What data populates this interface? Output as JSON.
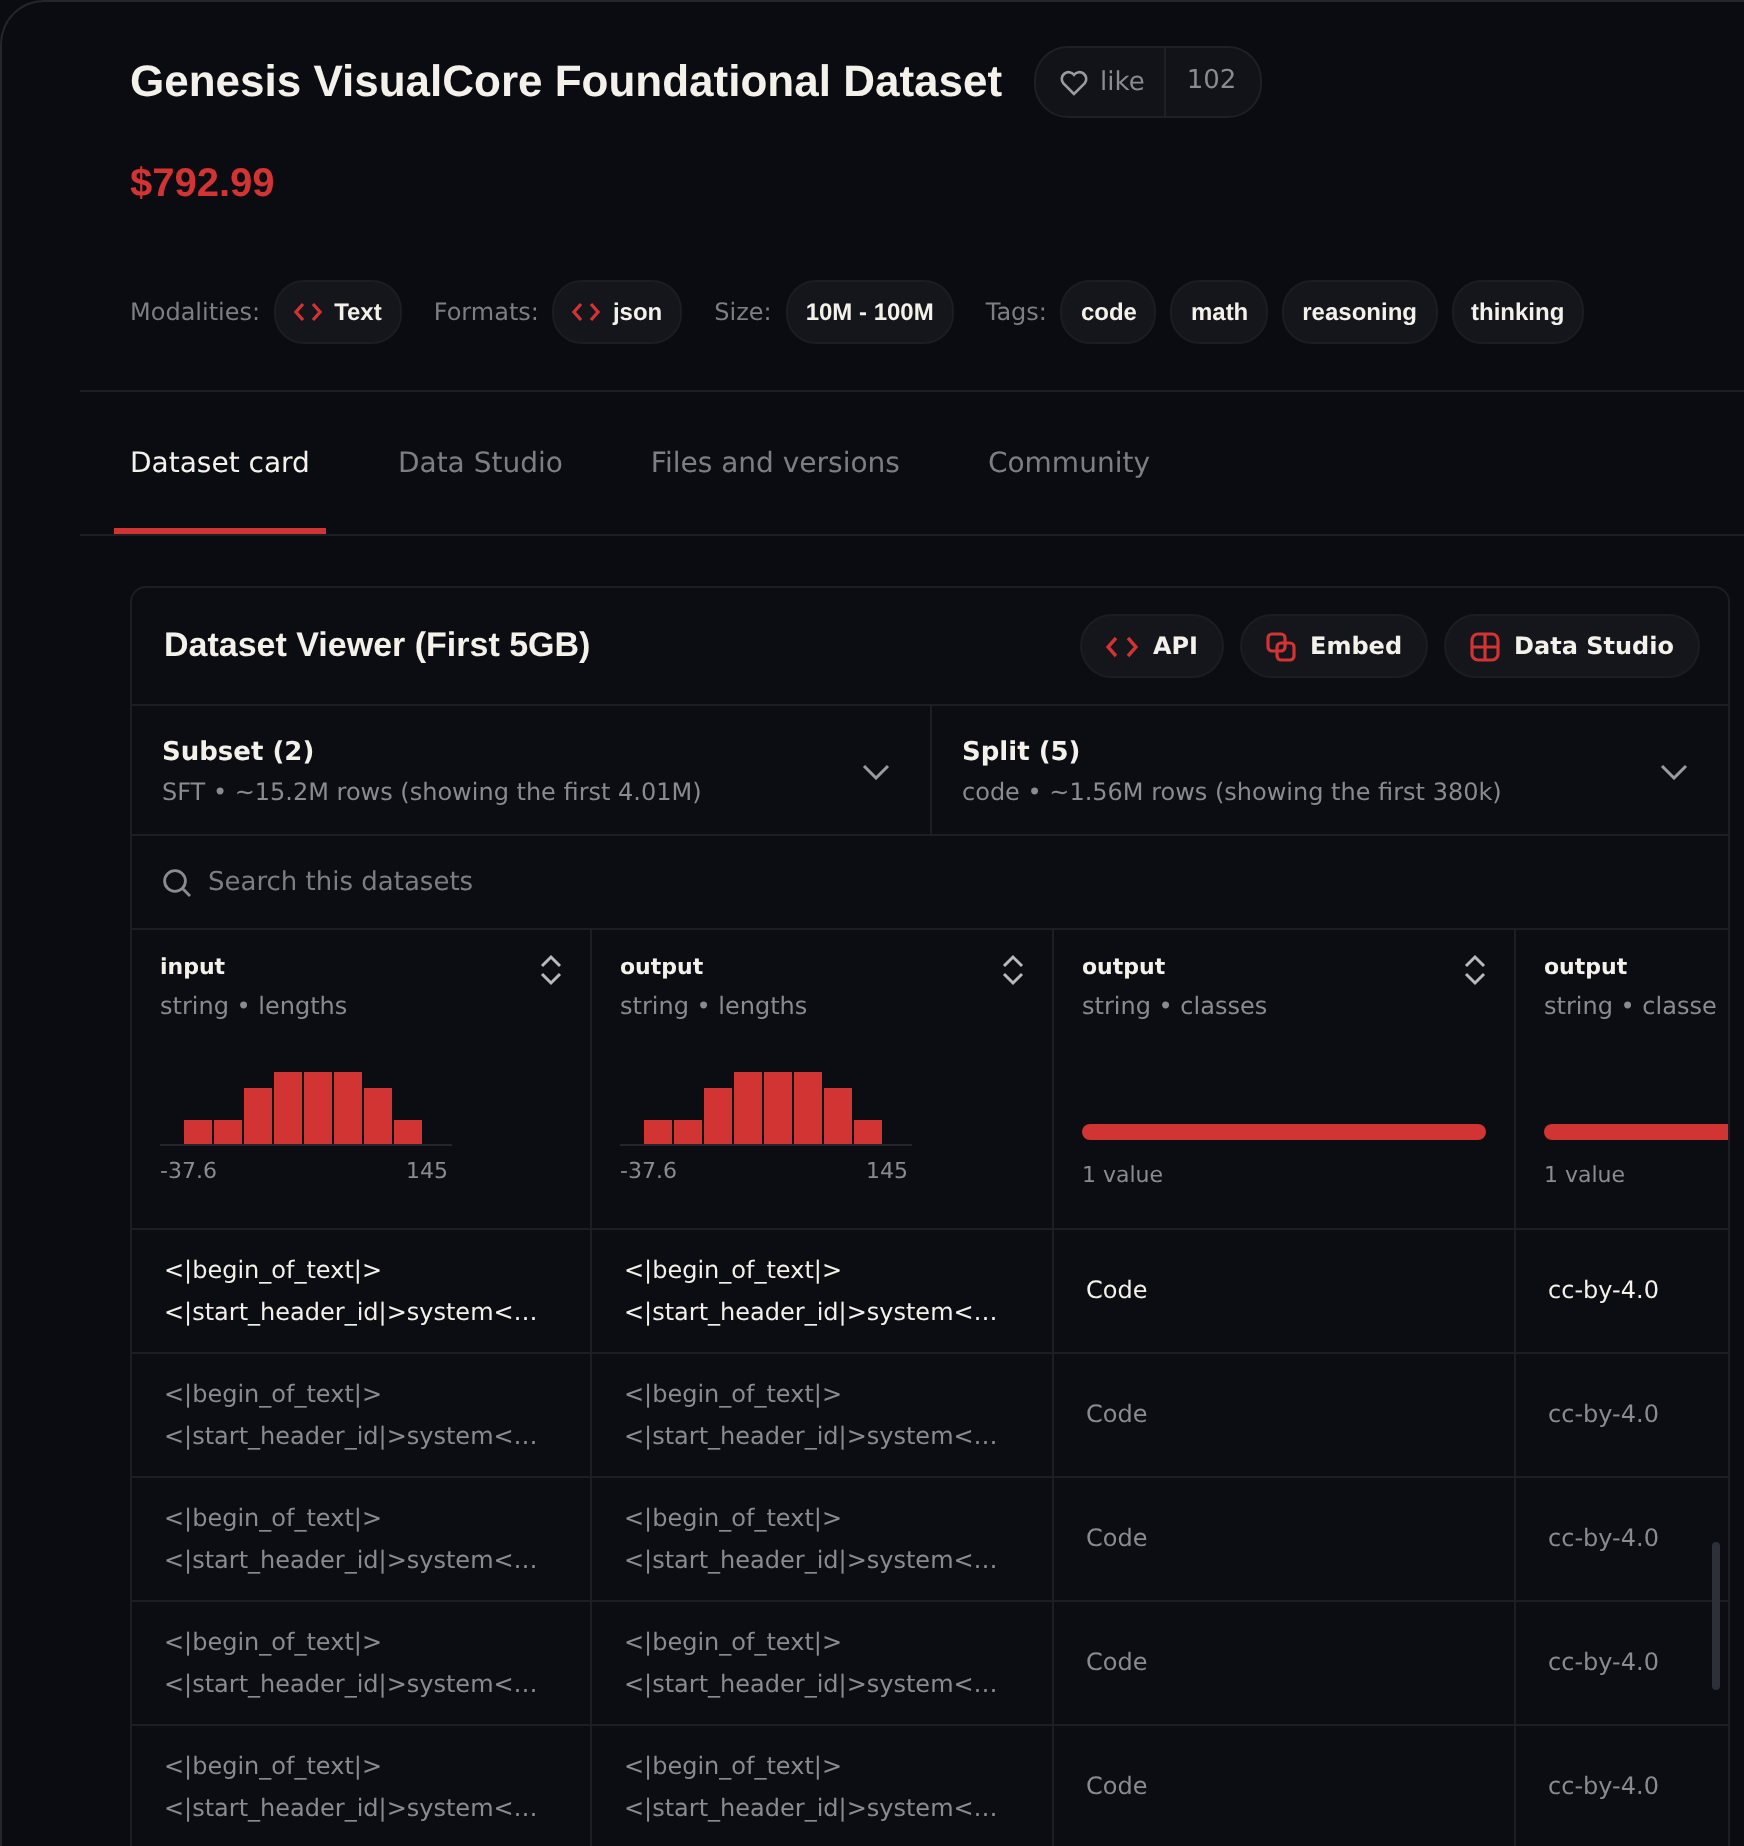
{
  "header": {
    "title": "Genesis VisualCore Foundational Dataset",
    "like": {
      "label": "like",
      "count": "102"
    },
    "price": "$792.99"
  },
  "meta": [
    {
      "label": "Modalities:",
      "chips": [
        {
          "text": "Text",
          "icon": true
        }
      ]
    },
    {
      "label": "Formats:",
      "chips": [
        {
          "text": "json",
          "icon": true
        }
      ]
    },
    {
      "label": "Size:",
      "chips": [
        {
          "text": "10M - 100M",
          "icon": false
        }
      ]
    },
    {
      "label": "Tags:",
      "chips": [
        {
          "text": "code",
          "icon": false
        },
        {
          "text": "math",
          "icon": false
        },
        {
          "text": "reasoning",
          "icon": false
        },
        {
          "text": "thinking",
          "icon": false
        }
      ]
    }
  ],
  "tabs": [
    {
      "label": "Dataset card",
      "selected": true
    },
    {
      "label": "Data Studio",
      "selected": false
    },
    {
      "label": "Files and versions",
      "selected": false
    },
    {
      "label": "Community",
      "selected": false
    }
  ],
  "viewer": {
    "title": "Dataset Viewer (First 5GB)",
    "buttons": [
      {
        "label": "API",
        "kind": "api"
      },
      {
        "label": "Embed",
        "kind": "embed"
      },
      {
        "label": "Data Studio",
        "kind": "studio"
      }
    ],
    "selectors": [
      {
        "title": "Subset (2)",
        "subtitle": "SFT • ~15.2M rows (showing the first 4.01M)"
      },
      {
        "title": "Split (5)",
        "subtitle": "code • ~1.56M rows (showing the first 380k)"
      }
    ],
    "search": {
      "placeholder": "Search this datasets"
    },
    "columns": [
      {
        "name": "input",
        "type": "string • lengths",
        "kind": "histogram",
        "min": "-37.6",
        "max": "145"
      },
      {
        "name": "output",
        "type": "string • lengths",
        "kind": "histogram",
        "min": "-37.6",
        "max": "145"
      },
      {
        "name": "output",
        "type": "string • classes",
        "kind": "classes",
        "summary": "1 value"
      },
      {
        "name": "output",
        "type": "string • classe",
        "kind": "classes",
        "summary": "1 value"
      }
    ],
    "rows": [
      {
        "selected": true,
        "cells": [
          "<|begin_of_text|>\n<|start_header_id|>system<…",
          "<|begin_of_text|>\n<|start_header_id|>system<…",
          "Code",
          "cc-by-4.0"
        ]
      },
      {
        "selected": false,
        "cells": [
          "<|begin_of_text|>\n<|start_header_id|>system<…",
          "<|begin_of_text|>\n<|start_header_id|>system<…",
          "Code",
          "cc-by-4.0"
        ]
      },
      {
        "selected": false,
        "cells": [
          "<|begin_of_text|>\n<|start_header_id|>system<…",
          "<|begin_of_text|>\n<|start_header_id|>system<…",
          "Code",
          "cc-by-4.0"
        ]
      },
      {
        "selected": false,
        "cells": [
          "<|begin_of_text|>\n<|start_header_id|>system<…",
          "<|begin_of_text|>\n<|start_header_id|>system<…",
          "Code",
          "cc-by-4.0"
        ]
      },
      {
        "selected": false,
        "cells": [
          "<|begin_of_text|>\n<|start_header_id|>system<…",
          "<|begin_of_text|>\n<|start_header_id|>system<…",
          "Code",
          "cc-by-4.0"
        ]
      }
    ]
  }
}
